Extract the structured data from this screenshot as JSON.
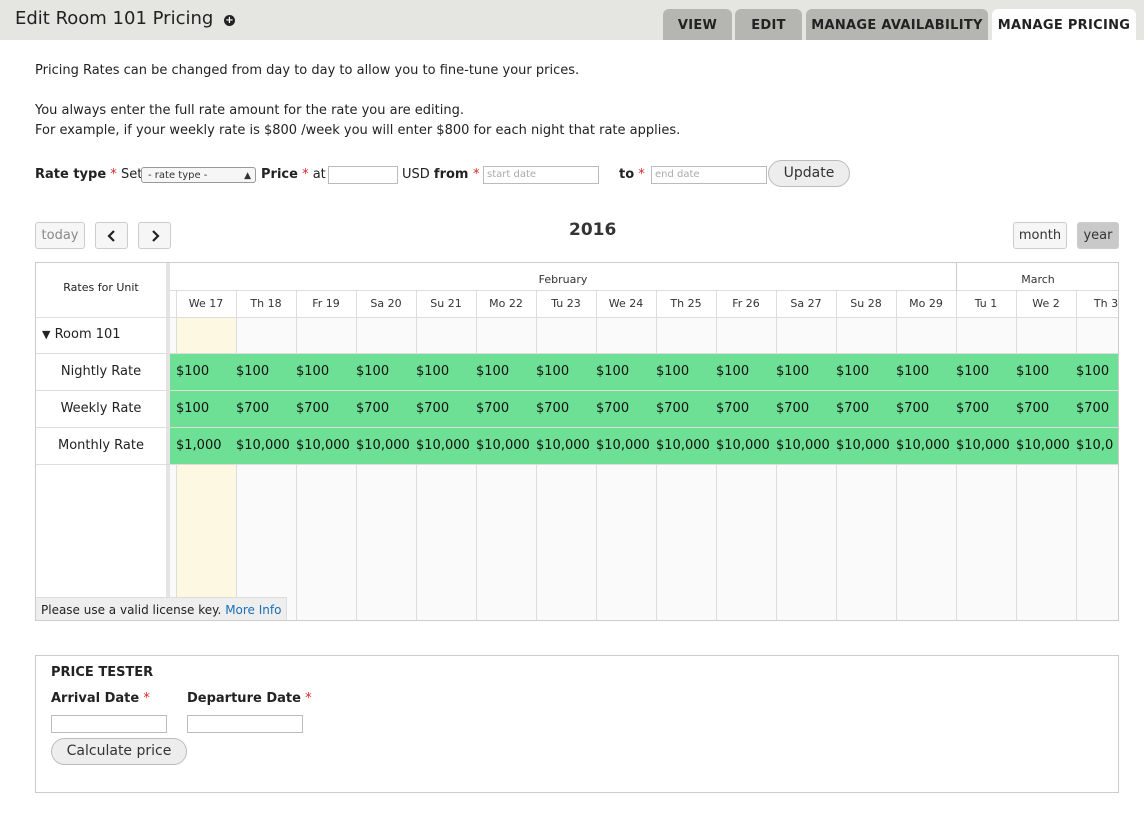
{
  "header": {
    "title": "Edit Room 101 Pricing",
    "tabs": [
      "VIEW",
      "EDIT",
      "MANAGE AVAILABILITY",
      "MANAGE PRICING"
    ]
  },
  "intro": {
    "line1": "Pricing Rates can be changed from day to day to allow you to fine-tune your prices.",
    "line2": "You always enter the full rate amount for the rate you are editing.",
    "line3": "For example, if your weekly rate is $800 /week you will enter $800 for each night that rate applies."
  },
  "form": {
    "rate_type_label": "Rate type",
    "required_mark": "*",
    "set_text": "Set",
    "rate_type_value": "- rate type -",
    "price_label": "Price",
    "at_text": "at",
    "usd_text": "USD",
    "from_label": "from",
    "start_placeholder": "start date",
    "to_label": "to",
    "end_placeholder": "end date",
    "update_label": "Update"
  },
  "calendar": {
    "today_label": "today",
    "prev_icon": "chevron-left-icon",
    "next_icon": "chevron-right-icon",
    "year": "2016",
    "month_label": "month",
    "year_label": "year",
    "resource_header": "Rates for Unit",
    "months": [
      "February",
      "March"
    ],
    "days": [
      "We 17",
      "Th 18",
      "Fr 19",
      "Sa 20",
      "Su 21",
      "Mo 22",
      "Tu 23",
      "We 24",
      "Th 25",
      "Fr 26",
      "Sa 27",
      "Su 28",
      "Mo 29",
      "Tu 1",
      "We 2",
      "Th 3"
    ],
    "unit": "Room 101",
    "rows": [
      {
        "name": "Nightly Rate",
        "values": [
          "$100",
          "$100",
          "$100",
          "$100",
          "$100",
          "$100",
          "$100",
          "$100",
          "$100",
          "$100",
          "$100",
          "$100",
          "$100",
          "$100",
          "$100",
          "$100"
        ]
      },
      {
        "name": "Weekly Rate",
        "values": [
          "$100",
          "$700",
          "$700",
          "$700",
          "$700",
          "$700",
          "$700",
          "$700",
          "$700",
          "$700",
          "$700",
          "$700",
          "$700",
          "$700",
          "$700",
          "$700"
        ]
      },
      {
        "name": "Monthly Rate",
        "values": [
          "$1,000",
          "$10,000",
          "$10,000",
          "$10,000",
          "$10,000",
          "$10,000",
          "$10,000",
          "$10,000",
          "$10,000",
          "$10,000",
          "$10,000",
          "$10,000",
          "$10,000",
          "$10,000",
          "$10,000",
          "$10,0"
        ]
      }
    ],
    "license_text": "Please use a valid license key.",
    "license_link": "More Info",
    "rate_color": "#6de096",
    "today_color": "#fdf8e1"
  },
  "tester": {
    "title": "PRICE TESTER",
    "arrival_label": "Arrival Date",
    "departure_label": "Departure Date",
    "calculate_label": "Calculate price"
  }
}
